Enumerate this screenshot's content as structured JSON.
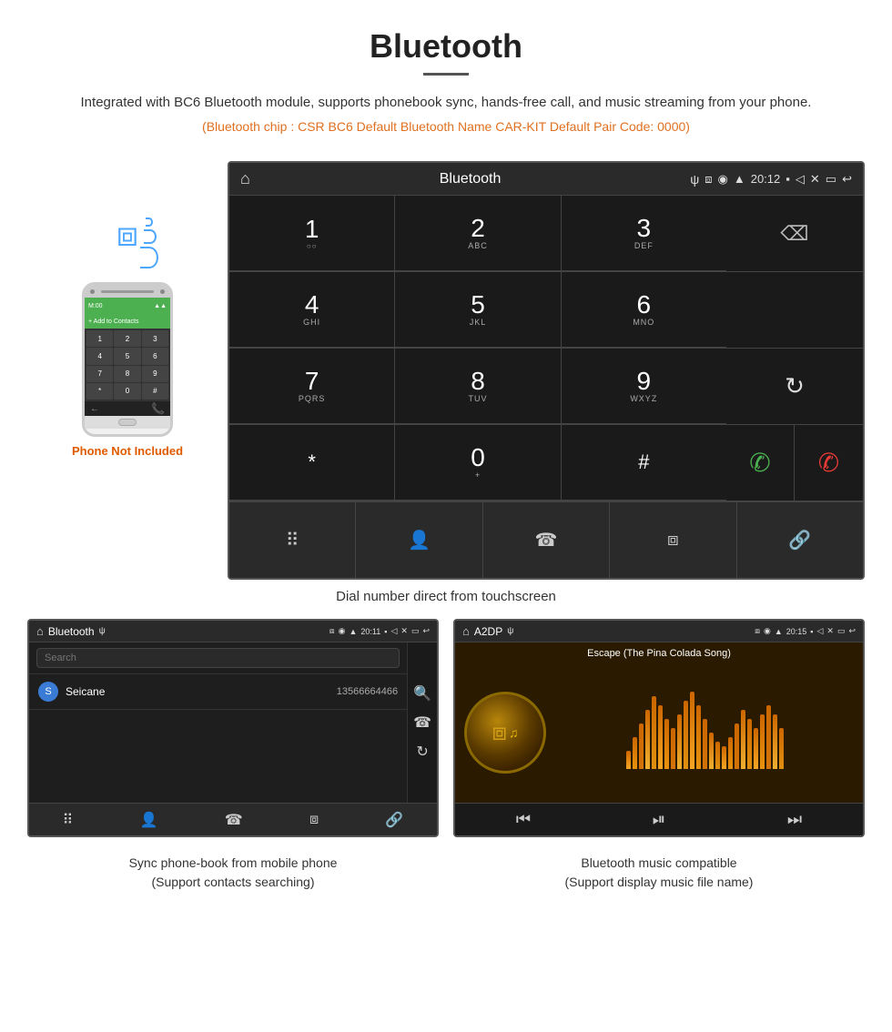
{
  "header": {
    "title": "Bluetooth",
    "description": "Integrated with BC6 Bluetooth module, supports phonebook sync, hands-free call, and music streaming from your phone.",
    "specs": "(Bluetooth chip : CSR BC6    Default Bluetooth Name CAR-KIT    Default Pair Code: 0000)"
  },
  "phone_aside": {
    "not_included": "Phone Not Included"
  },
  "dial_screen": {
    "top_bar": {
      "title": "Bluetooth",
      "time": "20:12"
    },
    "dial_keys": [
      {
        "num": "1",
        "letters": "◌◌"
      },
      {
        "num": "2",
        "letters": "ABC"
      },
      {
        "num": "3",
        "letters": "DEF"
      },
      {
        "num": "4",
        "letters": "GHI"
      },
      {
        "num": "5",
        "letters": "JKL"
      },
      {
        "num": "6",
        "letters": "MNO"
      },
      {
        "num": "7",
        "letters": "PQRS"
      },
      {
        "num": "8",
        "letters": "TUV"
      },
      {
        "num": "9",
        "letters": "WXYZ"
      },
      {
        "num": "*",
        "letters": ""
      },
      {
        "num": "0",
        "letters": "+"
      },
      {
        "num": "#",
        "letters": ""
      }
    ],
    "caption": "Dial number direct from touchscreen"
  },
  "phonebook_screen": {
    "top_bar": {
      "title": "Bluetooth",
      "time": "20:11"
    },
    "search_placeholder": "Search",
    "contacts": [
      {
        "letter": "S",
        "name": "Seicane",
        "number": "13566664466"
      }
    ],
    "caption_line1": "Sync phone-book from mobile phone",
    "caption_line2": "(Support contacts searching)"
  },
  "music_screen": {
    "top_bar": {
      "title": "A2DP",
      "time": "20:15"
    },
    "song_title": "Escape (The Pina Colada Song)",
    "eq_bars": [
      20,
      35,
      50,
      65,
      80,
      70,
      55,
      45,
      60,
      75,
      85,
      70,
      55,
      40,
      30,
      25,
      35,
      50,
      65,
      55,
      45,
      60,
      70,
      60,
      45
    ],
    "caption_line1": "Bluetooth music compatible",
    "caption_line2": "(Support display music file name)"
  },
  "icons": {
    "home": "⌂",
    "usb": "ψ",
    "bluetooth": "ᛒ",
    "gps": "◉",
    "signal": "▲",
    "battery": "▮",
    "camera": "⬛",
    "volume": "◁",
    "close_x": "✕",
    "screen": "⬜",
    "back": "↩",
    "delete": "⌫",
    "refresh": "↻",
    "call_green": "✆",
    "call_red": "✆",
    "dialpad": "⠿",
    "person": "👤",
    "phone": "☎",
    "bt_nav": "ᛒ",
    "link": "🔗",
    "search": "🔍",
    "previous": "⏮",
    "play_pause": "⏯",
    "next": "⏭"
  }
}
